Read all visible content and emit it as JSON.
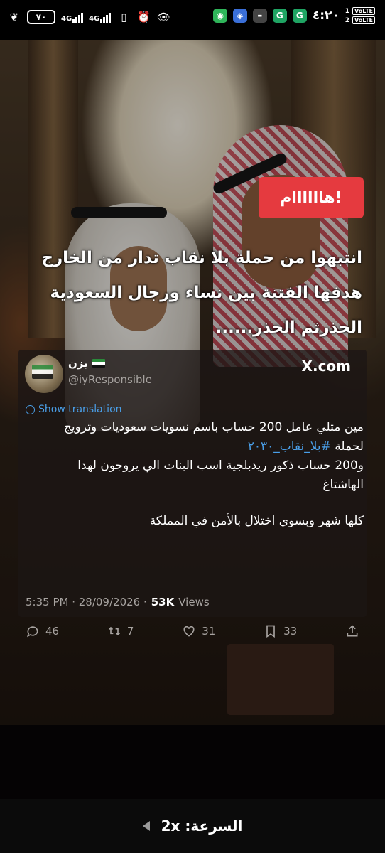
{
  "status_bar": {
    "battery": "٧٠",
    "signal1": "4G",
    "signal2": "4G",
    "time": "٤:٢٠",
    "sim1_volte": "VoLTE",
    "sim2_volte": "VoLTE",
    "sim1_index": "1",
    "sim2_index": "2"
  },
  "overlay": {
    "tag_text": "هاااااام!",
    "headline_lines": [
      "انتبهوا من حملة بلا نقاب تدار من الخارج",
      "هدفها الفتنة بين نساء ورجال السعودية",
      "الحذرثم الحذر......"
    ]
  },
  "tweet": {
    "display_name": "يزن",
    "handle": "@iyResponsible",
    "source": "X.com",
    "show_translation": "Show translation",
    "body_line1": "مين متلي عامل 200 حساب باسم نسويات سعوديات وترويج",
    "body_line2_prefix": "لحملة ",
    "hashtag": "#بلا_نقاب_٢٠٣٠",
    "body_line3": "و200 حساب ذكور ريدبلجية اسب البنات الي يروجون لهدا",
    "body_line4": "الهاشتاغ",
    "body_line5": "كلها شهر وبسوي اختلال بالأمن في المملكة",
    "timestamp": "5:35 PM · 28/09/2026 ·",
    "views_count": "53K",
    "views_label": "Views",
    "replies": "46",
    "retweets": "7",
    "likes": "31",
    "bookmarks": "33"
  },
  "playback": {
    "speed_label": "السرعة: 2x"
  }
}
